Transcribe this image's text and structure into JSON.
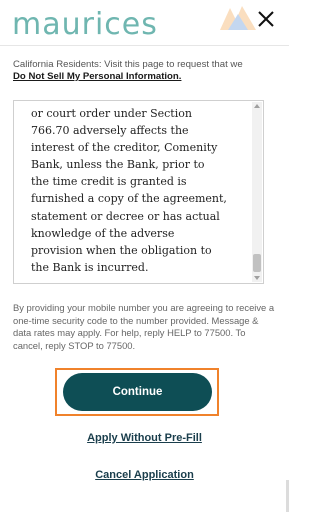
{
  "header": {
    "logo_text": "maurices",
    "close_icon": "close-icon"
  },
  "notice": {
    "ca_text": "California Residents: Visit this page to request that we",
    "ca_link": "Do Not Sell My Personal Information."
  },
  "terms": {
    "lines": [
      "or court order under Section",
      "766.70 adversely affects the",
      "interest of the creditor, Comenity",
      "Bank, unless the Bank, prior to",
      "the time credit is granted is",
      "furnished a copy of the agreement,",
      "statement or decree or has actual",
      "knowledge of the adverse",
      "provision when the obligation to",
      "the Bank is incurred."
    ]
  },
  "disclaimer": "By providing your mobile number you are agreeing to receive a one-time security code to the number provided. Message & data rates may apply. For help, reply HELP to 77500. To cancel, reply STOP to 77500.",
  "actions": {
    "continue_label": "Continue",
    "apply_without_label": "Apply Without Pre-Fill",
    "cancel_label": "Cancel Application"
  },
  "colors": {
    "brand": "#6fb6b0",
    "primary_button": "#0e4e55",
    "focus_ring": "#f0822b",
    "link": "#1a3e4c"
  }
}
